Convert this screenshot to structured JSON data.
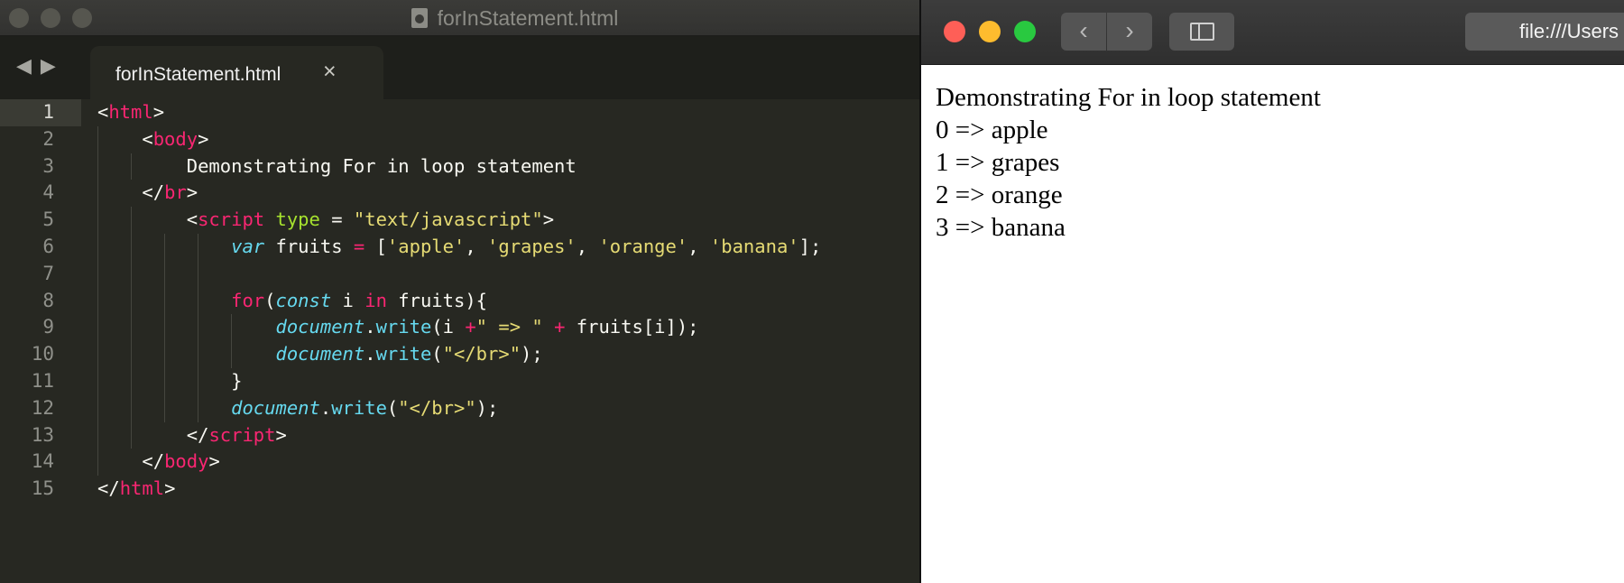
{
  "editor": {
    "window_title": "forInStatement.html",
    "tab_label": "forInStatement.html",
    "tab_close": "×",
    "nav_back": "◀",
    "nav_forward": "▶",
    "line_numbers": [
      "1",
      "2",
      "3",
      "4",
      "5",
      "6",
      "7",
      "8",
      "9",
      "10",
      "11",
      "12",
      "13",
      "14",
      "15"
    ],
    "code": {
      "l1": {
        "lt": "<",
        "tag": "html",
        "gt": ">"
      },
      "l2": {
        "lt": "<",
        "tag": "body",
        "gt": ">"
      },
      "l3": {
        "text": "Demonstrating For in loop statement"
      },
      "l4": {
        "lt": "</",
        "tag": "br",
        "gt": ">"
      },
      "l5": {
        "lt": "<",
        "tag": "script",
        "attr": "type",
        "eq": " = ",
        "val": "\"text/javascript\"",
        "gt": ">"
      },
      "l6": {
        "kw": "var",
        "name": " fruits ",
        "op": "=",
        "pre": " [",
        "s1": "'apple'",
        "c1": ", ",
        "s2": "'grapes'",
        "c2": ", ",
        "s3": "'orange'",
        "c3": ", ",
        "s4": "'banana'",
        "post": "];"
      },
      "l8": {
        "kw": "for",
        "p1": "(",
        "stor": "const",
        "mid1": " i ",
        "kw2": "in",
        "mid2": " fruits){"
      },
      "l9": {
        "obj": "document",
        "dot": ".",
        "fn": "write",
        "p1": "(i ",
        "op1": "+",
        "s1": "\" => \"",
        "sp": " ",
        "op2": "+",
        "rest": " fruits[i]);"
      },
      "l10": {
        "obj": "document",
        "dot": ".",
        "fn": "write",
        "p1": "(",
        "s1": "\"</br>\"",
        "rest": ");"
      },
      "l11": {
        "text": "}"
      },
      "l12": {
        "obj": "document",
        "dot": ".",
        "fn": "write",
        "p1": "(",
        "s1": "\"</br>\"",
        "rest": ");"
      },
      "l13": {
        "lt": "</",
        "tag": "script",
        "gt": ">"
      },
      "l14": {
        "lt": "</",
        "tag": "body",
        "gt": ">"
      },
      "l15": {
        "lt": "</",
        "tag": "html",
        "gt": ">"
      }
    }
  },
  "browser": {
    "address": "file:///Users",
    "back": "‹",
    "forward": "›",
    "output_lines": [
      "Demonstrating For in loop statement",
      "0 => apple",
      "1 => grapes",
      "2 => orange",
      "3 => banana"
    ]
  },
  "colors": {
    "editor_bg": "#272822",
    "tag": "#f92672",
    "string": "#e6db74",
    "attribute": "#a6e22e",
    "storage": "#66d9ef"
  }
}
